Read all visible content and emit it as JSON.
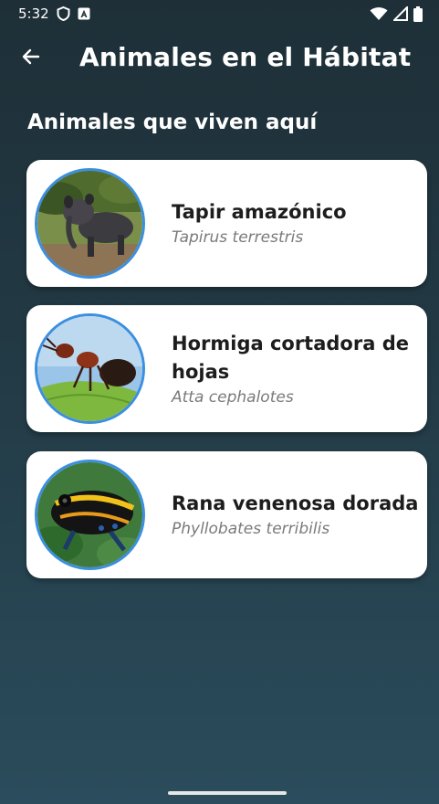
{
  "status_bar": {
    "time": "5:32"
  },
  "app_bar": {
    "title": "Animales en el Hábitat",
    "back_icon": "arrow-left-icon"
  },
  "section": {
    "title": "Animales que viven aquí"
  },
  "animals": [
    {
      "name": "Tapir amazónico",
      "scientific": "Tapirus terrestris"
    },
    {
      "name": "Hormiga cortadora de hojas",
      "scientific": "Atta cephalotes"
    },
    {
      "name": "Rana venenosa dorada",
      "scientific": "Phyllobates terribilis"
    }
  ],
  "colors": {
    "accent": "#3b8fe0",
    "card": "#ffffff",
    "background": "#223a45"
  }
}
